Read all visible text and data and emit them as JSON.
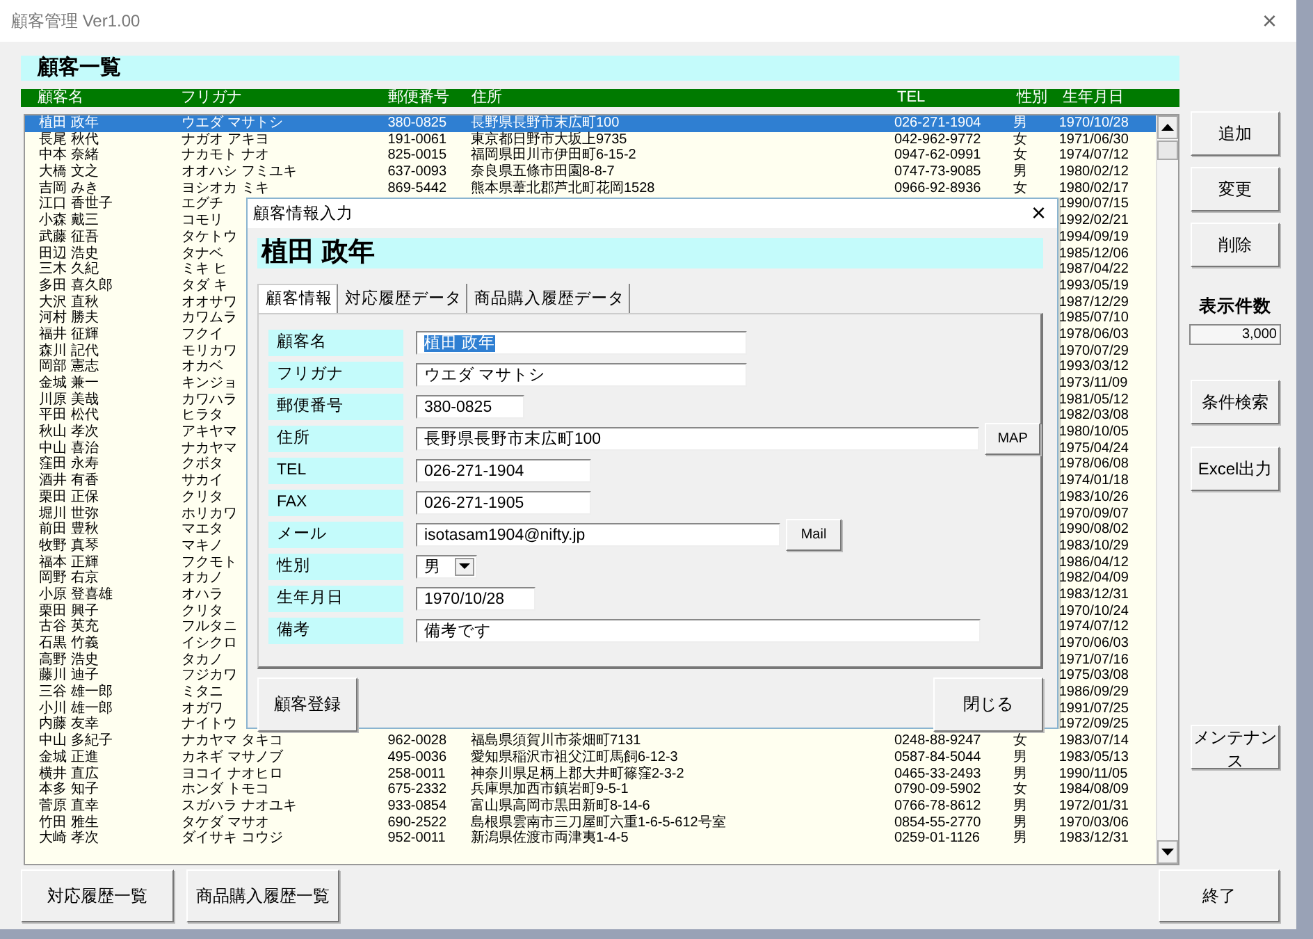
{
  "window": {
    "title": "顧客管理 Ver1.00",
    "close": "×"
  },
  "list_title": "顧客一覧",
  "columns": [
    "顧客名",
    "フリガナ",
    "郵便番号",
    "住所",
    "TEL",
    "性別",
    "生年月日"
  ],
  "rows": [
    {
      "name": "植田 政年",
      "furigana": "ウエダ マサトシ",
      "zip": "380-0825",
      "address": "長野県長野市末広町100",
      "tel": "026-271-1904",
      "sex": "男",
      "birth": "1970/10/28",
      "selected": true
    },
    {
      "name": "長尾 秋代",
      "furigana": "ナガオ アキヨ",
      "zip": "191-0061",
      "address": "東京都日野市大坂上9735",
      "tel": "042-962-9772",
      "sex": "女",
      "birth": "1971/06/30",
      "selected": false
    },
    {
      "name": "中本 奈緒",
      "furigana": "ナカモト ナオ",
      "zip": "825-0015",
      "address": "福岡県田川市伊田町6-15-2",
      "tel": "0947-62-0991",
      "sex": "女",
      "birth": "1974/07/12",
      "selected": false
    },
    {
      "name": "大橋 文之",
      "furigana": "オオハシ フミユキ",
      "zip": "637-0093",
      "address": "奈良県五條市田園8-8-7",
      "tel": "0747-73-9085",
      "sex": "男",
      "birth": "1980/02/12",
      "selected": false
    },
    {
      "name": "吉岡 みき",
      "furigana": "ヨシオカ ミキ",
      "zip": "869-5442",
      "address": "熊本県葦北郡芦北町花岡1528",
      "tel": "0966-92-8936",
      "sex": "女",
      "birth": "1980/02/17",
      "selected": false
    },
    {
      "name": "江口 香世子",
      "furigana": "エグチ",
      "birth": "1990/07/15",
      "selected": false
    },
    {
      "name": "小森 戴三",
      "furigana": "コモリ",
      "birth": "1992/02/21",
      "selected": false
    },
    {
      "name": "武藤 征吾",
      "furigana": "タケトウ",
      "birth": "1994/09/19",
      "selected": false
    },
    {
      "name": "田辺 浩史",
      "furigana": "タナベ",
      "birth": "1985/12/06",
      "selected": false
    },
    {
      "name": "三木 久紀",
      "furigana": "ミキ ヒ",
      "birth": "1987/04/22",
      "selected": false
    },
    {
      "name": "多田 喜久郎",
      "furigana": "タダ キ",
      "birth": "1993/05/19",
      "selected": false
    },
    {
      "name": "大沢 直秋",
      "furigana": "オオサワ",
      "birth": "1987/12/29",
      "selected": false
    },
    {
      "name": "河村 勝夫",
      "furigana": "カワムラ",
      "birth": "1985/07/10",
      "selected": false
    },
    {
      "name": "福井 征輝",
      "furigana": "フクイ",
      "birth": "1978/06/03",
      "selected": false
    },
    {
      "name": "森川 記代",
      "furigana": "モリカワ",
      "birth": "1970/07/29",
      "selected": false
    },
    {
      "name": "岡部 憲志",
      "furigana": "オカベ",
      "birth": "1993/03/12",
      "selected": false
    },
    {
      "name": "金城 兼一",
      "furigana": "キンジョ",
      "birth": "1973/11/09",
      "selected": false
    },
    {
      "name": "川原 美哉",
      "furigana": "カワハラ",
      "birth": "1981/05/12",
      "selected": false
    },
    {
      "name": "平田 松代",
      "furigana": "ヒラタ",
      "birth": "1982/03/08",
      "selected": false
    },
    {
      "name": "秋山 孝次",
      "furigana": "アキヤマ",
      "birth": "1980/10/05",
      "selected": false
    },
    {
      "name": "中山 喜治",
      "furigana": "ナカヤマ",
      "birth": "1975/04/24",
      "selected": false
    },
    {
      "name": "窪田 永寿",
      "furigana": "クボタ",
      "birth": "1978/06/08",
      "selected": false
    },
    {
      "name": "酒井 有香",
      "furigana": "サカイ",
      "birth": "1974/01/18",
      "selected": false
    },
    {
      "name": "栗田 正保",
      "furigana": "クリタ",
      "birth": "1983/10/26",
      "selected": false
    },
    {
      "name": "堀川 世弥",
      "furigana": "ホリカワ",
      "birth": "1970/09/07",
      "selected": false
    },
    {
      "name": "前田 豊秋",
      "furigana": "マエタ",
      "birth": "1990/08/02",
      "selected": false
    },
    {
      "name": "牧野 真琴",
      "furigana": "マキノ",
      "birth": "1983/10/29",
      "selected": false
    },
    {
      "name": "福本 正輝",
      "furigana": "フクモト",
      "birth": "1986/04/12",
      "selected": false
    },
    {
      "name": "岡野 右京",
      "furigana": "オカノ",
      "birth": "1982/04/09",
      "selected": false
    },
    {
      "name": "小原 登喜雄",
      "furigana": "オハラ",
      "birth": "1983/12/31",
      "selected": false
    },
    {
      "name": "栗田 興子",
      "furigana": "クリタ",
      "birth": "1970/10/24",
      "selected": false
    },
    {
      "name": "古谷 英充",
      "furigana": "フルタニ",
      "birth": "1974/07/12",
      "selected": false
    },
    {
      "name": "石黒 竹義",
      "furigana": "イシクロ",
      "birth": "1970/06/03",
      "selected": false
    },
    {
      "name": "高野 浩史",
      "furigana": "タカノ",
      "birth": "1971/07/16",
      "selected": false
    },
    {
      "name": "藤川 迪子",
      "furigana": "フジカワ",
      "birth": "1975/03/08",
      "selected": false
    },
    {
      "name": "三谷 雄一郎",
      "furigana": "ミタニ",
      "birth": "1986/09/29",
      "selected": false
    },
    {
      "name": "小川 雄一郎",
      "furigana": "オガワ",
      "birth": "1991/07/25",
      "selected": false
    },
    {
      "name": "内藤 友幸",
      "furigana": "ナイトウ",
      "birth": "1972/09/25",
      "selected": false
    },
    {
      "name": "中山 多紀子",
      "furigana": "ナカヤマ タキコ",
      "zip": "962-0028",
      "address": "福島県須賀川市茶畑町7131",
      "tel": "0248-88-9247",
      "sex": "女",
      "birth": "1983/07/14",
      "selected": false
    },
    {
      "name": "金城 正進",
      "furigana": "カネギ マサノブ",
      "zip": "495-0036",
      "address": "愛知県稲沢市祖父江町馬飼6-12-3",
      "tel": "0587-84-5044",
      "sex": "男",
      "birth": "1983/05/13",
      "selected": false
    },
    {
      "name": "横井 直広",
      "furigana": "ヨコイ ナオヒロ",
      "zip": "258-0011",
      "address": "神奈川県足柄上郡大井町篠窪2-3-2",
      "tel": "0465-33-2493",
      "sex": "男",
      "birth": "1990/11/05",
      "selected": false
    },
    {
      "name": "本多 知子",
      "furigana": "ホンダ トモコ",
      "zip": "675-2332",
      "address": "兵庫県加西市鎮岩町9-5-1",
      "tel": "0790-09-5902",
      "sex": "女",
      "birth": "1984/08/09",
      "selected": false
    },
    {
      "name": "菅原 直幸",
      "furigana": "スガハラ ナオユキ",
      "zip": "933-0854",
      "address": "富山県高岡市黒田新町8-14-6",
      "tel": "0766-78-8612",
      "sex": "男",
      "birth": "1972/01/31",
      "selected": false
    },
    {
      "name": "竹田 雅生",
      "furigana": "タケダ マサオ",
      "zip": "690-2522",
      "address": "島根県雲南市三刀屋町六重1-6-5-612号室",
      "tel": "0854-55-2770",
      "sex": "男",
      "birth": "1970/03/06",
      "selected": false
    },
    {
      "name": "大崎 孝次",
      "furigana": "ダイサキ コウジ",
      "zip": "952-0011",
      "address": "新潟県佐渡市両津夷1-4-5",
      "tel": "0259-01-1126",
      "sex": "男",
      "birth": "1983/12/31",
      "selected": false
    }
  ],
  "side": [
    {
      "kind": "button",
      "label": "追加"
    },
    {
      "kind": "button",
      "label": "変更"
    },
    {
      "kind": "button",
      "label": "削除"
    },
    {
      "kind": "counter",
      "label": "表示件数",
      "value": "3,000"
    },
    {
      "kind": "button",
      "label": "条件検索"
    },
    {
      "kind": "button",
      "label": "Excel出力"
    },
    {
      "kind": "button",
      "label": "メンテナンス"
    }
  ],
  "bottom_buttons": [
    "対応履歴一覧",
    "商品購入履歴一覧"
  ],
  "exit_button": "終了",
  "dialog": {
    "title": "顧客情報入力",
    "close": "×",
    "header": "植田 政年",
    "tabs": [
      {
        "label": "顧客情報",
        "selected": true
      },
      {
        "label": "対応履歴データ",
        "selected": false
      },
      {
        "label": "商品購入履歴データ",
        "selected": false
      }
    ],
    "fields": [
      {
        "label": "顧客名",
        "kind": "text",
        "value": "植田 政年",
        "highlighted": true
      },
      {
        "label": "フリガナ",
        "kind": "text",
        "value": "ウエダ マサトシ",
        "highlighted": false
      },
      {
        "label": "郵便番号",
        "kind": "text",
        "value": "380-0825",
        "highlighted": false
      },
      {
        "label": "住所",
        "kind": "text",
        "value": "長野県長野市末広町100",
        "highlighted": false,
        "button": "MAP"
      },
      {
        "label": "TEL",
        "kind": "text",
        "value": "026-271-1904",
        "highlighted": false
      },
      {
        "label": "FAX",
        "kind": "text",
        "value": "026-271-1905",
        "highlighted": false
      },
      {
        "label": "メール",
        "kind": "text",
        "value": "isotasam1904@nifty.jp",
        "highlighted": false,
        "button": "Mail"
      },
      {
        "label": "性別",
        "kind": "select",
        "value": "男",
        "highlighted": false
      },
      {
        "label": "生年月日",
        "kind": "text",
        "value": "1970/10/28",
        "highlighted": false
      },
      {
        "label": "備考",
        "kind": "text",
        "value": "備考です",
        "highlighted": false
      }
    ],
    "register_button": "顧客登録",
    "close_button": "閉じる"
  }
}
